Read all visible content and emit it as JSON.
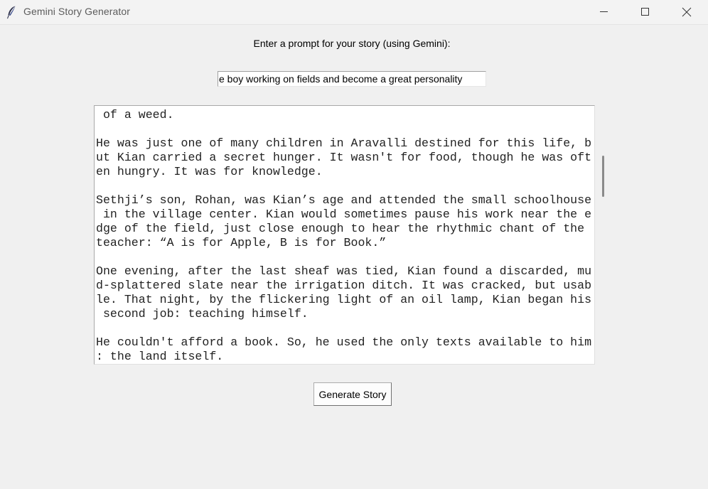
{
  "window": {
    "title": "Gemini Story Generator",
    "app_icon": "feather-icon",
    "controls": {
      "minimize_icon": "minimize-icon",
      "maximize_icon": "maximize-icon",
      "close_icon": "close-icon"
    }
  },
  "prompt": {
    "label": "Enter a prompt for your story (using Gemini):",
    "value": "e boy working on fields and become a great personality"
  },
  "story": {
    "lines": [
      " of a weed.",
      "",
      "He was just one of many children in Aravalli destined for this life, b",
      "ut Kian carried a secret hunger. It wasn't for food, though he was oft",
      "en hungry. It was for knowledge.",
      "",
      "Sethji’s son, Rohan, was Kian’s age and attended the small schoolhouse",
      " in the village center. Kian would sometimes pause his work near the e",
      "dge of the field, just close enough to hear the rhythmic chant of the",
      "teacher: “A is for Apple, B is for Book.”",
      "",
      "One evening, after the last sheaf was tied, Kian found a discarded, mu",
      "d-splattered slate near the irrigation ditch. It was cracked, but usab",
      "le. That night, by the flickering light of an oil lamp, Kian began his",
      " second job: teaching himself.",
      "",
      "He couldn't afford a book. So, he used the only texts available to him",
      ": the land itself."
    ]
  },
  "buttons": {
    "generate_label": "Generate Story"
  },
  "colors": {
    "window_bg": "#f0f0f0",
    "text_area_bg": "#ffffff",
    "title_text": "#5c5c5c"
  }
}
